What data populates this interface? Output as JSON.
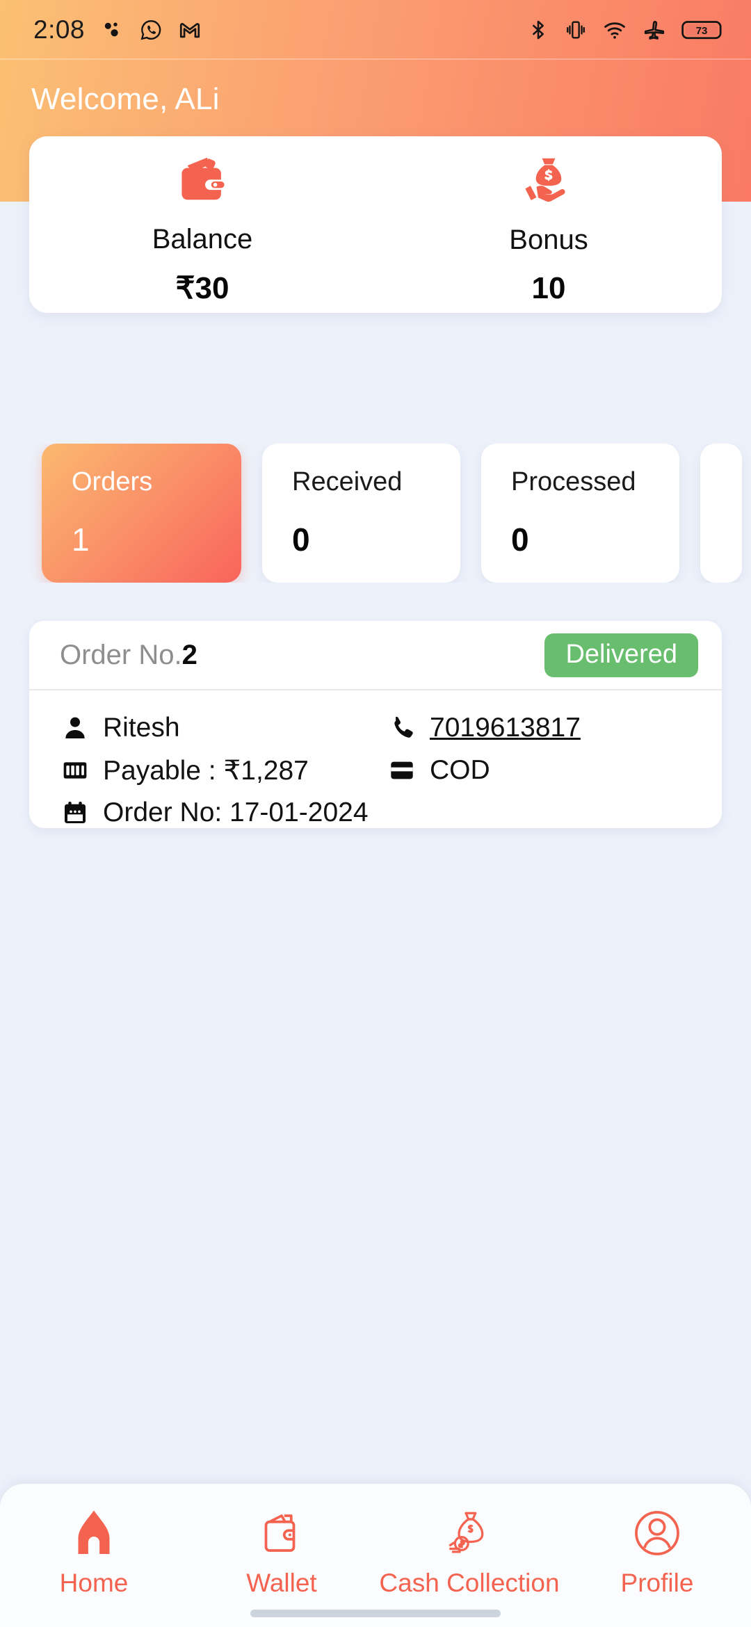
{
  "statusbar": {
    "time": "2:08",
    "left_icons": [
      "dots-icon",
      "whatsapp-icon",
      "gmail-icon"
    ],
    "right_icons": [
      "bluetooth-icon",
      "vibrate-icon",
      "wifi-icon",
      "airplane-mode-icon",
      "battery-icon"
    ],
    "battery_level": "73"
  },
  "header": {
    "greeting": "Welcome, ALi",
    "gradient_start": "#fbc073",
    "gradient_end": "#fa7a64"
  },
  "balance_card": {
    "balance": {
      "icon": "wallet-icon",
      "label": "Balance",
      "value": "₹30"
    },
    "bonus": {
      "icon": "money-bag-hand-icon",
      "label": "Bonus",
      "value": "10"
    }
  },
  "stats": [
    {
      "label": "Orders",
      "value": "1",
      "active": true
    },
    {
      "label": "Received",
      "value": "0",
      "active": false
    },
    {
      "label": "Processed",
      "value": "0",
      "active": false
    }
  ],
  "order": {
    "number_label": "Order No.",
    "number": "2",
    "status": "Delivered",
    "status_color": "#68be6e",
    "customer": {
      "icon": "person-icon",
      "name": "Ritesh"
    },
    "phone": {
      "icon": "phone-icon",
      "number": "7019613817"
    },
    "payable": {
      "icon": "banknote-icon",
      "text": "Payable : ₹1,287"
    },
    "payment_mode": {
      "icon": "credit-card-icon",
      "text": "COD"
    },
    "date": {
      "icon": "calendar-icon",
      "text": "Order No: 17-01-2024"
    }
  },
  "bottom_nav": {
    "accent_color": "#f4634f",
    "items": [
      {
        "label": "Home",
        "icon": "home-icon",
        "active": true
      },
      {
        "label": "Wallet",
        "icon": "wallet-outline-icon",
        "active": false
      },
      {
        "label": "Cash Collection",
        "icon": "cash-collection-icon",
        "active": false
      },
      {
        "label": "Profile",
        "icon": "profile-icon",
        "active": false
      }
    ]
  }
}
